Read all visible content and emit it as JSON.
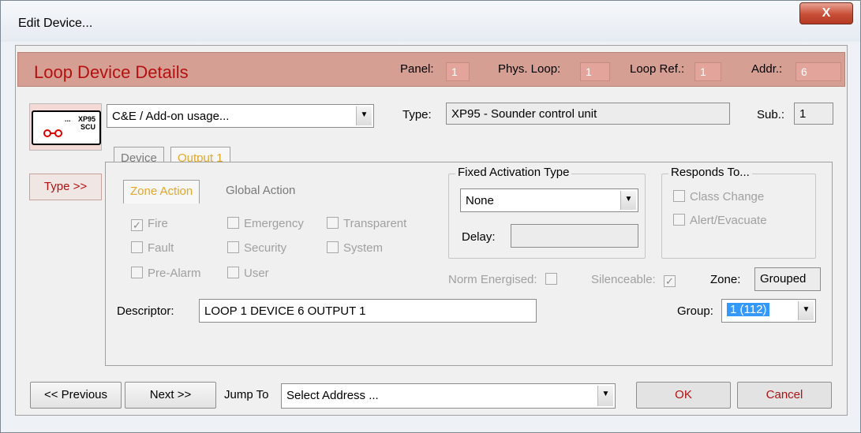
{
  "window": {
    "title": "Edit Device...",
    "close_glyph": "X"
  },
  "header": {
    "title": "Loop Device Details",
    "panel_label": "Panel:",
    "panel_value": "1",
    "phys_loop_label": "Phys. Loop:",
    "phys_loop_value": "1",
    "loop_ref_label": "Loop Ref.:",
    "loop_ref_value": "1",
    "addr_label": "Addr.:",
    "addr_value": "6"
  },
  "device": {
    "icon_text_line1": "XP95",
    "icon_text_line2": "SCU",
    "icon_decoration": "...",
    "icon_semantic": "sounder-control-unit-icon",
    "type_button": "Type >>",
    "usage_combo": "C&E / Add-on usage...",
    "type_label": "Type:",
    "type_value": "XP95 - Sounder control unit",
    "sub_label": "Sub.:",
    "sub_value": "1"
  },
  "tabs": [
    {
      "label": "Device",
      "active": false
    },
    {
      "label": "Output 1",
      "active": true
    }
  ],
  "action_tabs": [
    {
      "label": "Zone Action",
      "active": true
    },
    {
      "label": "Global Action",
      "active": false
    }
  ],
  "zone_checks": [
    {
      "label": "Fire",
      "checked": true
    },
    {
      "label": "Emergency",
      "checked": false
    },
    {
      "label": "Transparent",
      "checked": false
    },
    {
      "label": "Fault",
      "checked": false
    },
    {
      "label": "Security",
      "checked": false
    },
    {
      "label": "System",
      "checked": false
    },
    {
      "label": "Pre-Alarm",
      "checked": false
    },
    {
      "label": "User",
      "checked": false
    }
  ],
  "fixed_activation": {
    "legend": "Fixed Activation Type",
    "value": "None",
    "delay_label": "Delay:",
    "delay_value": ""
  },
  "responds_to": {
    "legend": "Responds To...",
    "class_change": "Class Change",
    "alert_evacuate": "Alert/Evacuate"
  },
  "flags": {
    "norm_energised_label": "Norm Energised:",
    "norm_energised_checked": false,
    "silenceable_label": "Silenceable:",
    "silenceable_checked": true,
    "zone_label": "Zone:",
    "zone_value": "Grouped"
  },
  "descriptor": {
    "label": "Descriptor:",
    "value": "LOOP 1 DEVICE 6 OUTPUT 1"
  },
  "group": {
    "label": "Group:",
    "value": "1 (112)"
  },
  "footer": {
    "previous": "<< Previous",
    "next": "Next >>",
    "jump_to_label": "Jump To",
    "jump_to_value": "Select Address ...",
    "ok": "OK",
    "cancel": "Cancel"
  },
  "colors": {
    "accent_red": "#b51010",
    "header_band": "#d69f94",
    "selection_blue": "#3399ff",
    "active_tab": "#e4a72a"
  }
}
